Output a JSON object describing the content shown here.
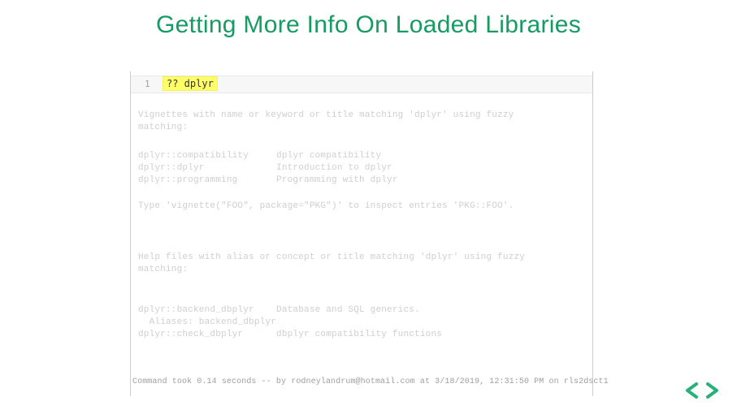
{
  "title": "Getting More Info On Loaded Libraries",
  "code": {
    "line_number": "1",
    "text": "?? dplyr"
  },
  "blocks": {
    "b1": "Vignettes with name or keyword or title matching 'dplyr' using fuzzy\nmatching:",
    "b2": "dplyr::compatibility     dplyr compatibility\ndplyr::dplyr             Introduction to dplyr\ndplyr::programming       Programming with dplyr",
    "b3": "Type 'vignette(\"FOO\", package=\"PKG\")' to inspect entries 'PKG::FOO'.",
    "b4": "Help files with alias or concept or title matching 'dplyr' using fuzzy\nmatching:",
    "b5": "dplyr::backend_dbplyr    Database and SQL generics.\n  Aliases: backend_dbplyr\ndplyr::check_dbplyr      dbplyr compatibility functions"
  },
  "footer": "Command took 0.14 seconds -- by rodneylandrum@hotmail.com at 3/18/2019, 12:31:50 PM on rls2dsct1"
}
